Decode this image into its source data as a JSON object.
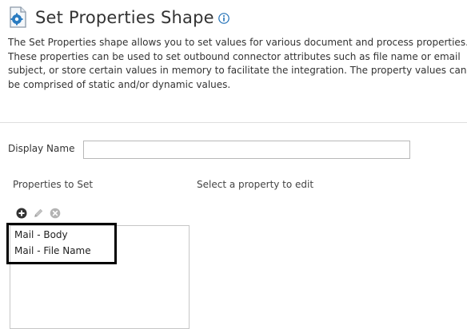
{
  "header": {
    "title": "Set Properties Shape",
    "icon": "document-settings-icon",
    "info_icon": "info-icon"
  },
  "description": {
    "lines": [
      "The Set Properties shape allows you to set values for various document and process properties.",
      "These properties can be used to set outbound connector attributes such as file name or email",
      "subject, or store certain values in memory to facilitate the integration. The property values can",
      "be comprised of static and/or dynamic values."
    ]
  },
  "display_name": {
    "label": "Display Name",
    "value": ""
  },
  "properties": {
    "label": "Properties to Set",
    "toolbar": [
      "add-icon",
      "edit-icon",
      "delete-icon"
    ],
    "items": [
      "Mail - Body",
      "Mail - File Name"
    ]
  },
  "editor": {
    "placeholder_text": "Select a property to edit"
  },
  "colors": {
    "accent_blue": "#1f6fb6",
    "icon_dark": "#333333",
    "icon_disabled": "#b3b3b3",
    "highlight": "#000000"
  }
}
